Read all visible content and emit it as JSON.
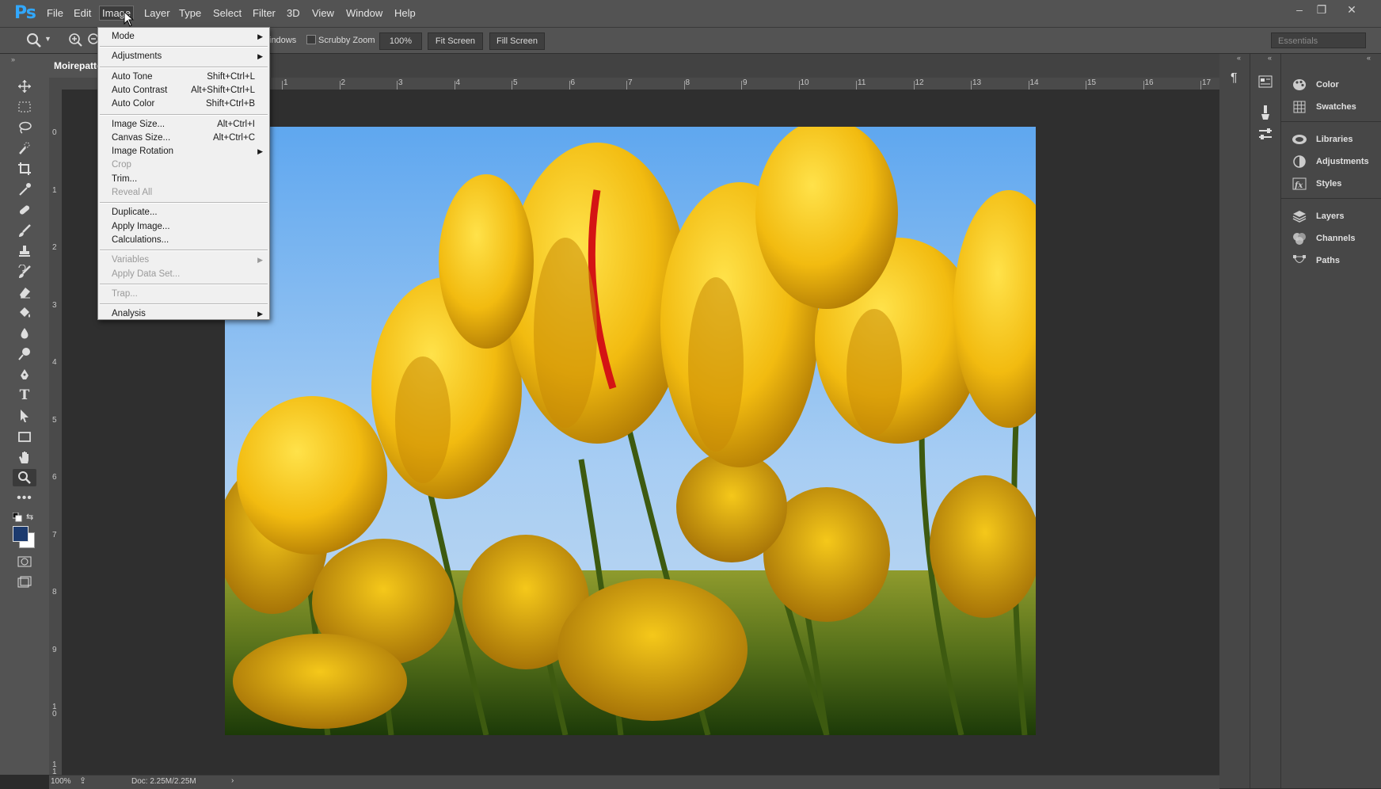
{
  "app": {
    "logo": "Ps"
  },
  "menubar": {
    "items": [
      "File",
      "Edit",
      "Image",
      "Layer",
      "Type",
      "Select",
      "Filter",
      "3D",
      "View",
      "Window",
      "Help"
    ],
    "window_controls": {
      "minimize": "–",
      "restore": "❐",
      "close": "✕"
    }
  },
  "options": {
    "windows_label": "indows",
    "scrubby_zoom_label": "Scrubby Zoom",
    "zoom_value": "100%",
    "fit_screen": "Fit Screen",
    "fill_screen": "Fill Screen",
    "workspace": "Essentials"
  },
  "document": {
    "tab_title": "Moirepatter"
  },
  "rulers": {
    "h": [
      "1",
      "2",
      "3",
      "4",
      "5",
      "6",
      "7",
      "8",
      "9",
      "10",
      "11",
      "12",
      "13",
      "14",
      "15",
      "16",
      "17"
    ],
    "v": [
      "0",
      "1",
      "2",
      "3",
      "4",
      "5",
      "6",
      "7",
      "8",
      "9",
      "1\n0",
      "1\n1"
    ]
  },
  "status": {
    "zoom": "100%",
    "doc": "Doc: 2.25M/2.25M"
  },
  "image_menu": {
    "items": [
      {
        "label": "Mode",
        "submenu": true
      },
      {
        "sep": true
      },
      {
        "label": "Adjustments",
        "submenu": true
      },
      {
        "sep": true
      },
      {
        "label": "Auto Tone",
        "shortcut": "Shift+Ctrl+L"
      },
      {
        "label": "Auto Contrast",
        "shortcut": "Alt+Shift+Ctrl+L"
      },
      {
        "label": "Auto Color",
        "shortcut": "Shift+Ctrl+B"
      },
      {
        "sep": true
      },
      {
        "label": "Image Size...",
        "shortcut": "Alt+Ctrl+I"
      },
      {
        "label": "Canvas Size...",
        "shortcut": "Alt+Ctrl+C"
      },
      {
        "label": "Image Rotation",
        "submenu": true
      },
      {
        "label": "Crop",
        "disabled": true
      },
      {
        "label": "Trim..."
      },
      {
        "label": "Reveal All",
        "disabled": true
      },
      {
        "sep": true
      },
      {
        "label": "Duplicate..."
      },
      {
        "label": "Apply Image..."
      },
      {
        "label": "Calculations..."
      },
      {
        "sep": true
      },
      {
        "label": "Variables",
        "submenu": true,
        "disabled": true
      },
      {
        "label": "Apply Data Set...",
        "disabled": true
      },
      {
        "sep": true
      },
      {
        "label": "Trap...",
        "disabled": true
      },
      {
        "sep": true
      },
      {
        "label": "Analysis",
        "submenu": true
      }
    ]
  },
  "panels": {
    "groups": [
      [
        "Color",
        "Swatches"
      ],
      [
        "Libraries",
        "Adjustments",
        "Styles"
      ],
      [
        "Layers",
        "Channels",
        "Paths"
      ]
    ]
  },
  "colors": {
    "foreground": "#1c3a6e",
    "background": "#ffffff",
    "accent": "#31a8ff"
  }
}
